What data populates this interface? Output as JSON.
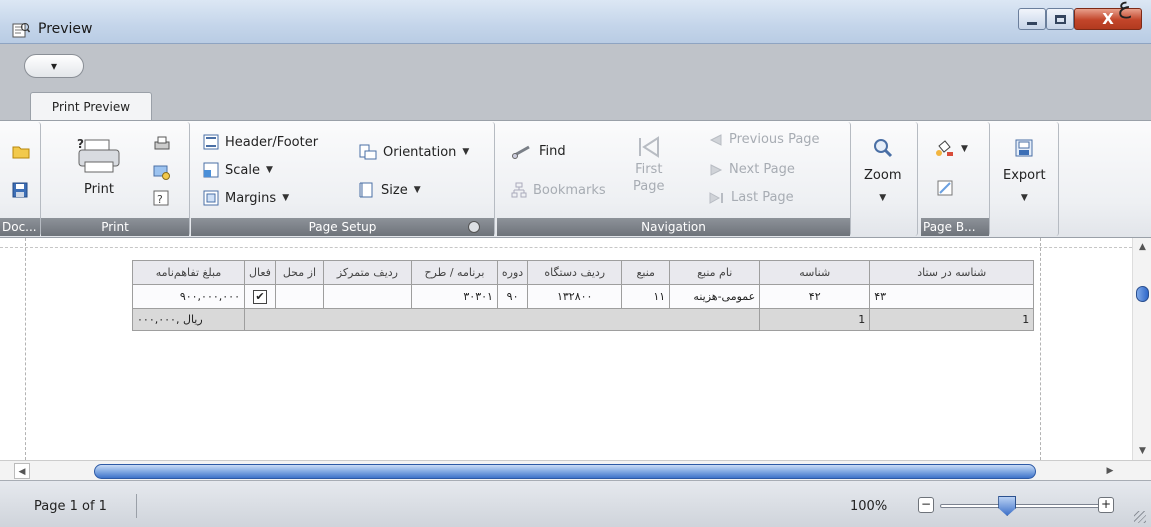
{
  "window": {
    "title": "Preview",
    "corner_mark": "ع"
  },
  "quick_access": {
    "label": "▾"
  },
  "tabs": [
    {
      "label": "Print Preview"
    }
  ],
  "ribbon": {
    "document_group": {
      "caption": "Doc..."
    },
    "print_group": {
      "caption": "Print",
      "print_label": "Print"
    },
    "page_setup_group": {
      "caption": "Page Setup",
      "header_footer": "Header/Footer",
      "scale": "Scale",
      "margins": "Margins",
      "orientation": "Orientation",
      "size": "Size"
    },
    "navigation_group": {
      "caption": "Navigation",
      "find": "Find",
      "bookmarks": "Bookmarks",
      "first_page_1": "First",
      "first_page_2": "Page",
      "previous_page": "Previous Page",
      "next_page": "Next Page",
      "last_page": "Last Page"
    },
    "zoom_group": {
      "label": "Zoom"
    },
    "page_background_group": {
      "caption": "Page B..."
    },
    "export_group": {
      "label": "Export"
    }
  },
  "report_table": {
    "headers": [
      "مبلغ تفاهم‌نامه",
      "فعال",
      "از محل",
      "ردیف متمرکز",
      "برنامه / طرح",
      "دوره",
      "ردیف دستگاه",
      "منبع",
      "نام منبع",
      "شناسه",
      "شناسه در ستاد"
    ],
    "rows": [
      {
        "amount": "۹۰۰,۰۰۰,۰۰۰",
        "active": true,
        "from": "",
        "central_row": "",
        "program": "۳۰۳۰۱",
        "period": "۹۰",
        "device_row": "۱۳۲۸۰۰",
        "source": "۱۱",
        "source_name": "عمومی-هزینه",
        "id": "۴۲",
        "hq_id": "۴۳"
      }
    ],
    "total": {
      "amount_text": "۰۰۰,۰۰۰, ریال",
      "count_id": "1",
      "count_hq": "1"
    }
  },
  "status_bar": {
    "page_info": "Page 1 of 1",
    "zoom_level": "100%",
    "zoom_fraction": 0.42
  }
}
